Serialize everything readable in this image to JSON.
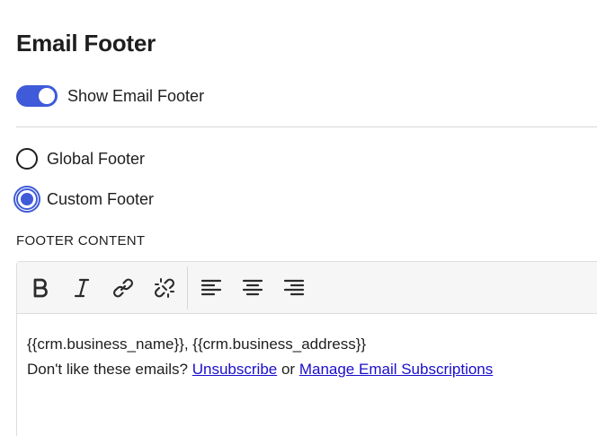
{
  "page": {
    "title": "Email Footer"
  },
  "toggle": {
    "label": "Show Email Footer",
    "checked": true,
    "color": "#3f5bd9"
  },
  "footer_type": {
    "options": [
      {
        "label": "Global Footer",
        "selected": false
      },
      {
        "label": "Custom Footer",
        "selected": true
      }
    ]
  },
  "footer_content": {
    "label": "FOOTER CONTENT",
    "toolbar": {
      "buttons": [
        "bold-icon",
        "italic-icon",
        "link-icon",
        "unlink-icon",
        "align-left-icon",
        "align-center-icon",
        "align-right-icon"
      ]
    },
    "line1": "{{crm.business_name}}, {{crm.business_address}}",
    "line2_prefix": "Don't like these emails?",
    "unsubscribe_link": "Unsubscribe",
    "connector": "or",
    "manage_link": "Manage Email Subscriptions"
  }
}
